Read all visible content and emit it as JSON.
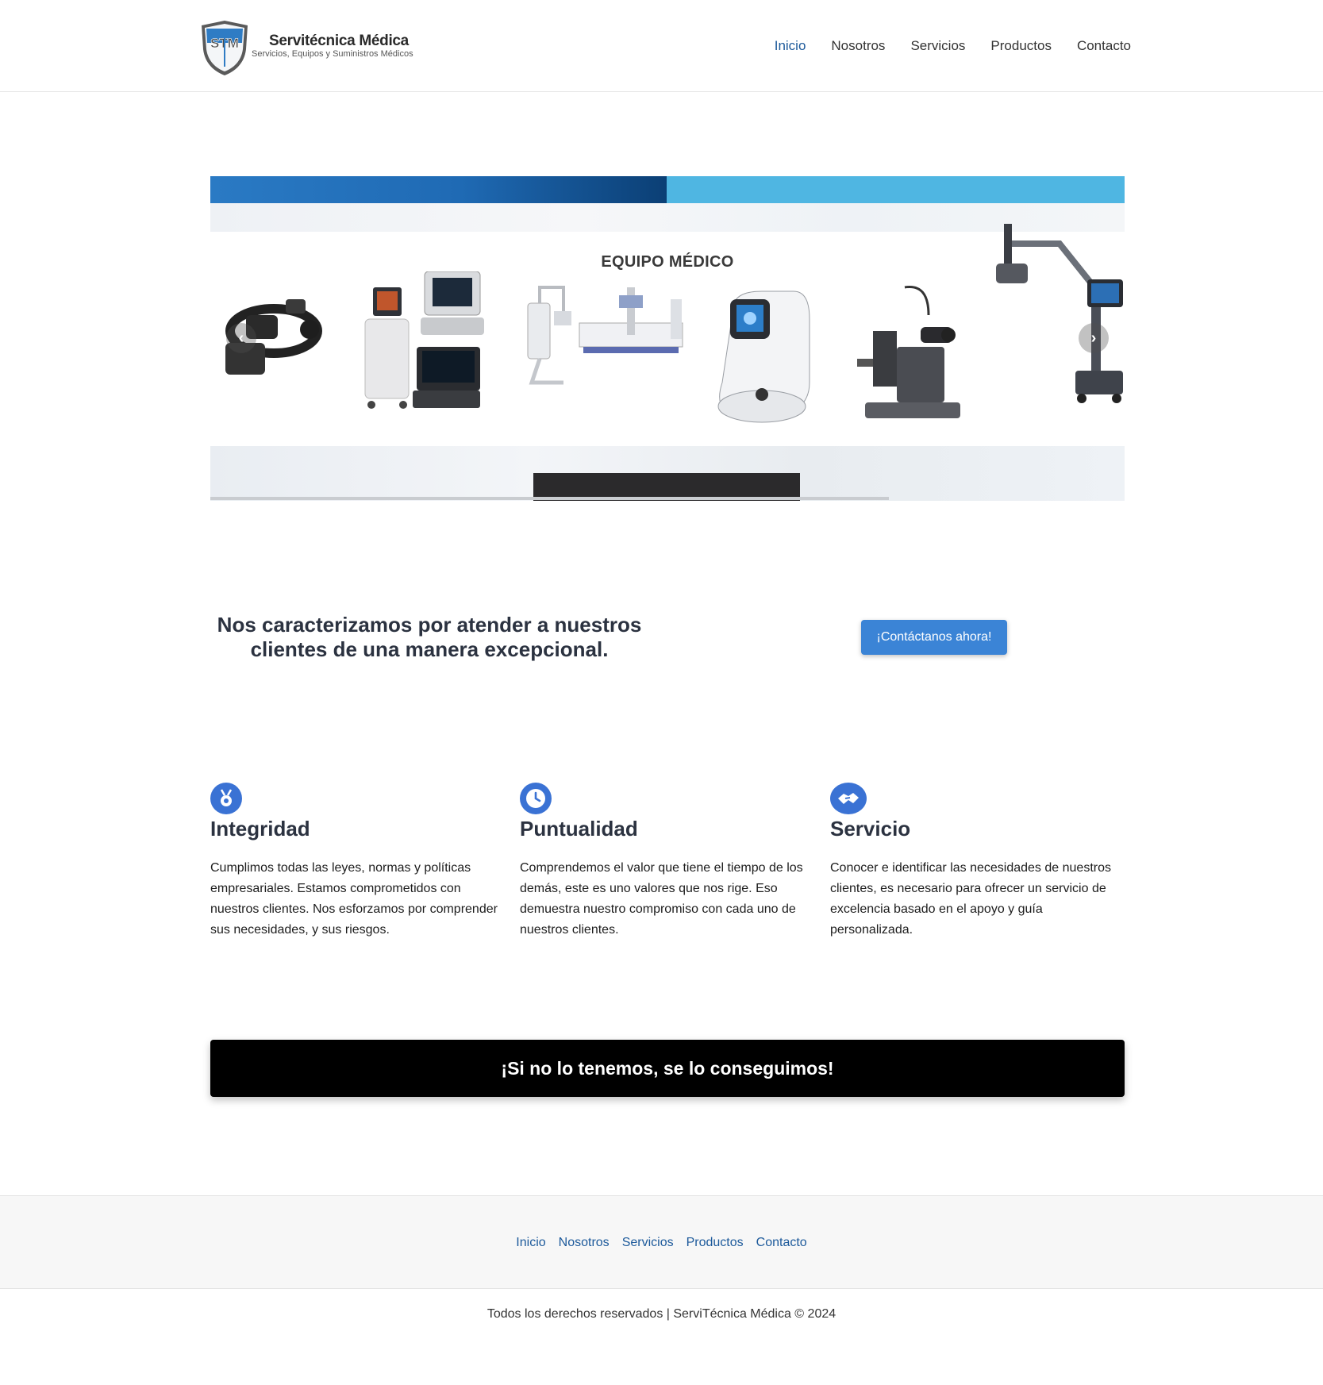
{
  "brand": {
    "logo_initials": "STM",
    "name": "Servitécnica Médica",
    "tagline": "Servicios, Equipos y Suministros Médicos"
  },
  "nav": [
    {
      "label": "Inicio",
      "active": true
    },
    {
      "label": "Nosotros",
      "active": false
    },
    {
      "label": "Servicios",
      "active": false
    },
    {
      "label": "Productos",
      "active": false
    },
    {
      "label": "Contacto",
      "active": false
    }
  ],
  "hero": {
    "slide_title": "EQUIPO MÉDICO",
    "prev_icon": "chevron-left-icon",
    "next_icon": "chevron-right-icon"
  },
  "cta": {
    "text": "Nos caracterizamos por atender a nuestros clientes de una manera excepcional.",
    "button": "¡Contáctanos ahora!"
  },
  "values": [
    {
      "icon": "medal-icon",
      "title": "Integridad",
      "text": "Cumplimos todas las leyes, normas y políticas empresariales. Estamos comprometidos con nuestros clientes. Nos esforzamos por comprender sus necesidades, y sus riesgos."
    },
    {
      "icon": "clock-icon",
      "title": "Puntualidad",
      "text": "Comprendemos el valor que tiene el tiempo de los demás, este es uno valores que nos rige.  Eso demuestra nuestro compromiso con cada uno de nuestros clientes."
    },
    {
      "icon": "handshake-icon",
      "title": "Servicio",
      "text": "Conocer e identificar las necesidades de nuestros clientes, es necesario para ofrecer un servicio de excelencia basado en el apoyo y guía personalizada."
    }
  ],
  "banner": {
    "text": "¡Si no lo tenemos, se lo conseguimos!"
  },
  "footer": {
    "links": [
      "Inicio",
      "Nosotros",
      "Servicios",
      "Productos",
      "Contacto"
    ],
    "copyright": "Todos los derechos reservados | ServiTécnica Médica © 2024"
  },
  "colors": {
    "accent": "#3b84d6",
    "link": "#1d5a9b",
    "icon_bg": "#3a72d4",
    "banner_bg": "#000000"
  }
}
